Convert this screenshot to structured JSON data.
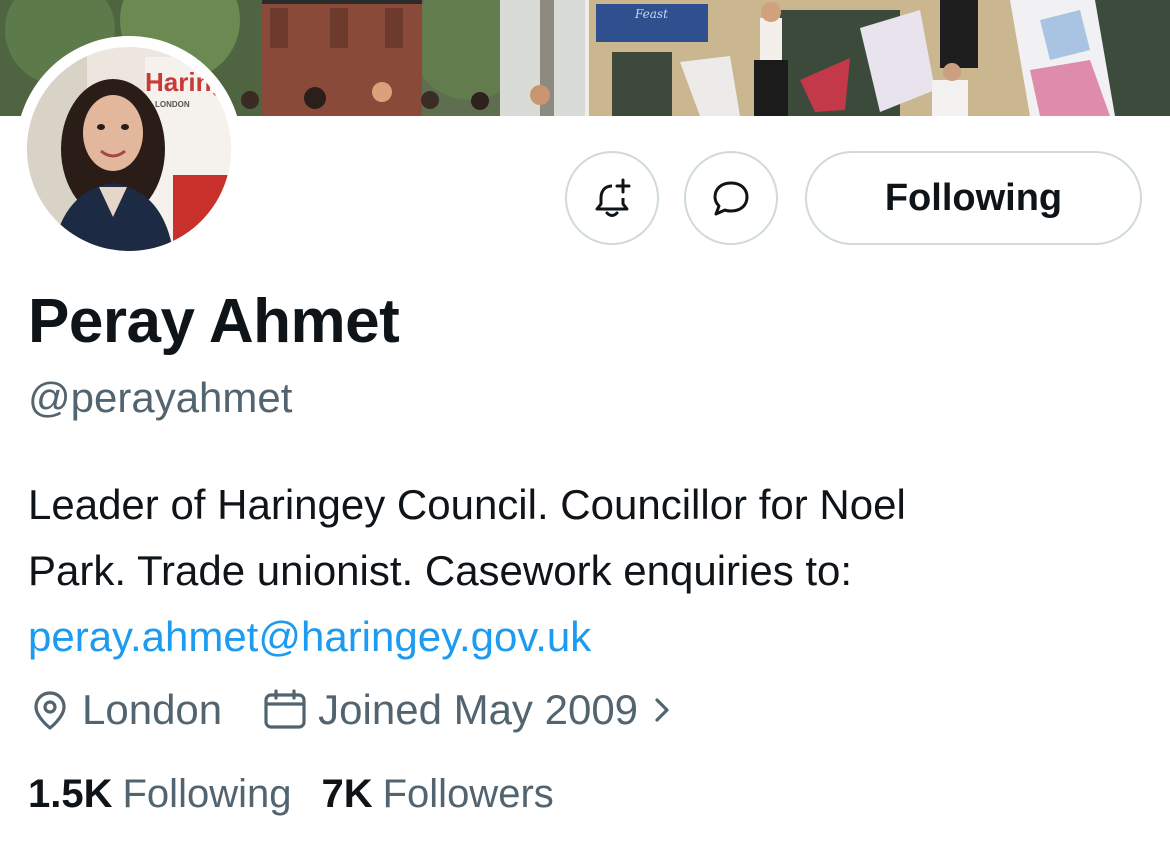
{
  "profile": {
    "display_name": "Peray Ahmet",
    "handle": "@perayahmet",
    "bio": {
      "line1": "Leader of Haringey Council. Councillor for Noel",
      "line2": "Park. Trade unionist. Casework enquiries to:",
      "email": "peray.ahmet@haringey.gov.uk"
    },
    "location": "London",
    "joined": "Joined May 2009",
    "stats": {
      "following_count": "1.5K",
      "following_label": "Following",
      "followers_count": "7K",
      "followers_label": "Followers"
    }
  },
  "banner": {
    "sign_text": "Feast"
  },
  "avatar": {
    "backdrop_logo": "Haring",
    "backdrop_sublabel": "LONDON"
  },
  "actions": {
    "following_label": "Following",
    "notify_icon": "bell-plus-icon",
    "message_icon": "message-bubble-icon"
  },
  "icons": {
    "location": "location-pin-icon",
    "calendar": "calendar-icon",
    "chevron": "chevron-right-icon"
  },
  "colors": {
    "text_primary": "#0f1419",
    "text_secondary": "#536471",
    "link": "#1d9bf0",
    "border": "#cfd9de"
  }
}
